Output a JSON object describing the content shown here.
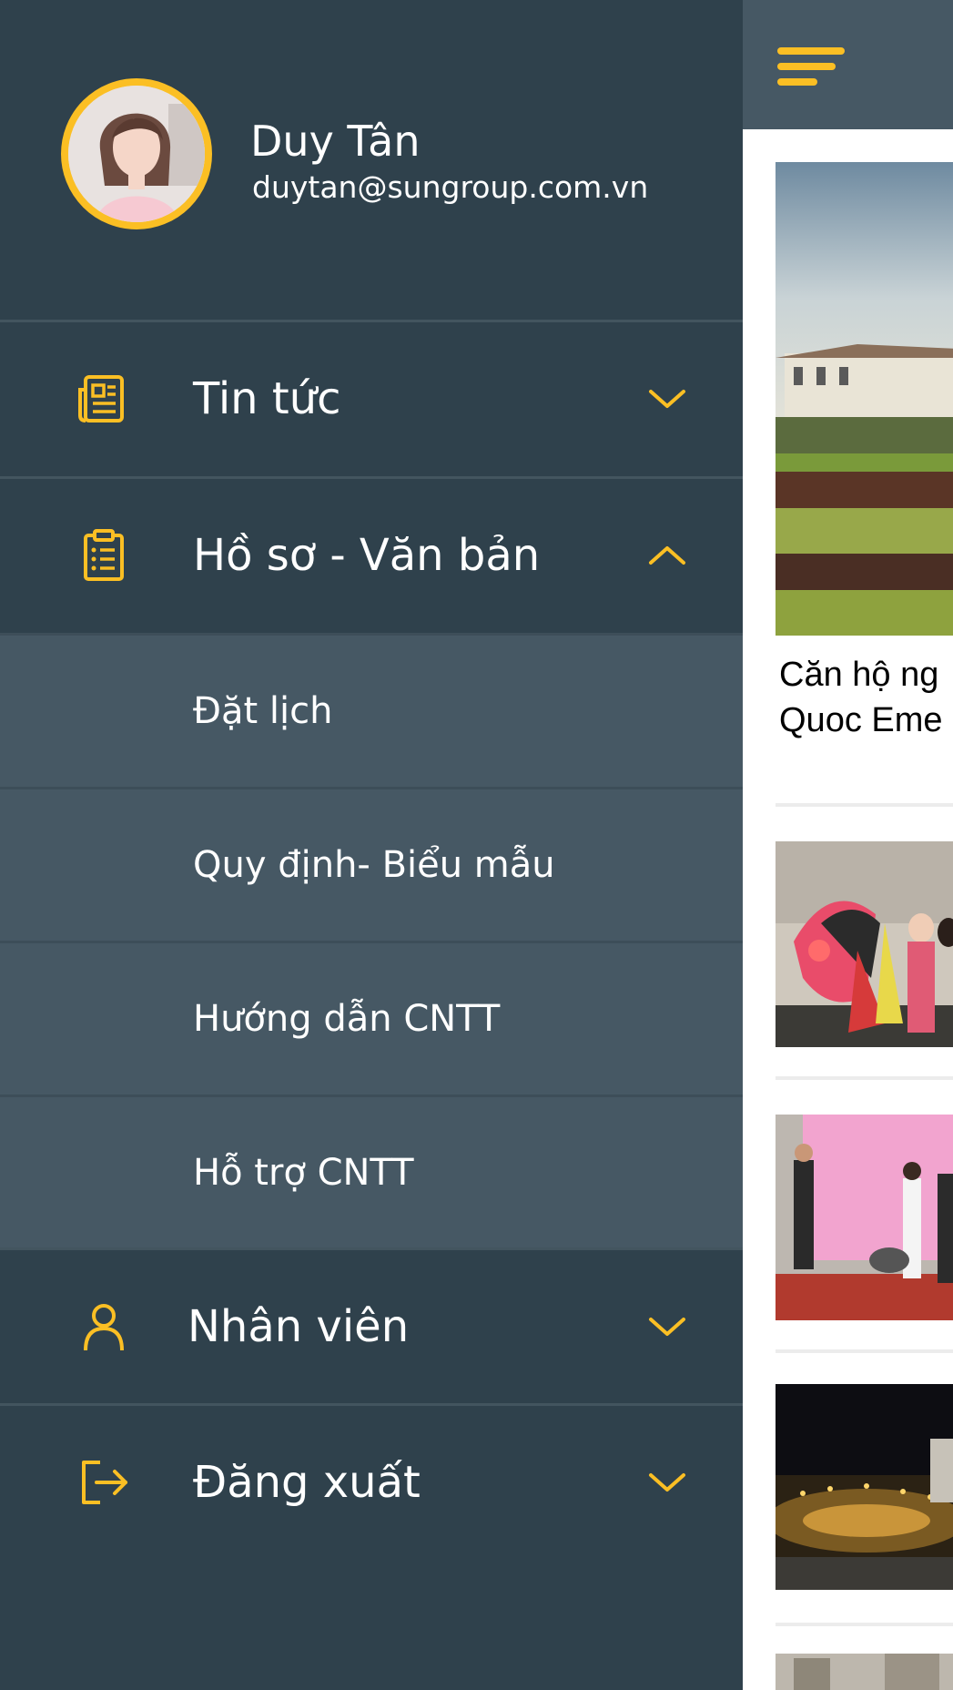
{
  "profile": {
    "name": "Duy Tân",
    "email": "duytan@sungroup.com.vn"
  },
  "menu": {
    "items": [
      {
        "label": "Tin tức",
        "icon": "newspaper-icon",
        "expanded": false
      },
      {
        "label": "Hồ sơ - Văn bản",
        "icon": "clipboard-icon",
        "expanded": true
      },
      {
        "label": "Nhân viên",
        "icon": "user-icon",
        "expanded": false
      },
      {
        "label": "Đăng xuất",
        "icon": "logout-icon",
        "expanded": false
      }
    ],
    "submenu": [
      {
        "label": "Đặt lịch"
      },
      {
        "label": "Quy định- Biểu mẫu"
      },
      {
        "label": "Hướng dẫn CNTT"
      },
      {
        "label": "Hỗ trợ CNTT"
      }
    ]
  },
  "news": {
    "first_title_line1": "Căn hộ ng",
    "first_title_line2": "Quoc Eme"
  },
  "colors": {
    "drawer_bg": "#2f414c",
    "submenu_bg": "#465864",
    "accent": "#fbbf24"
  }
}
